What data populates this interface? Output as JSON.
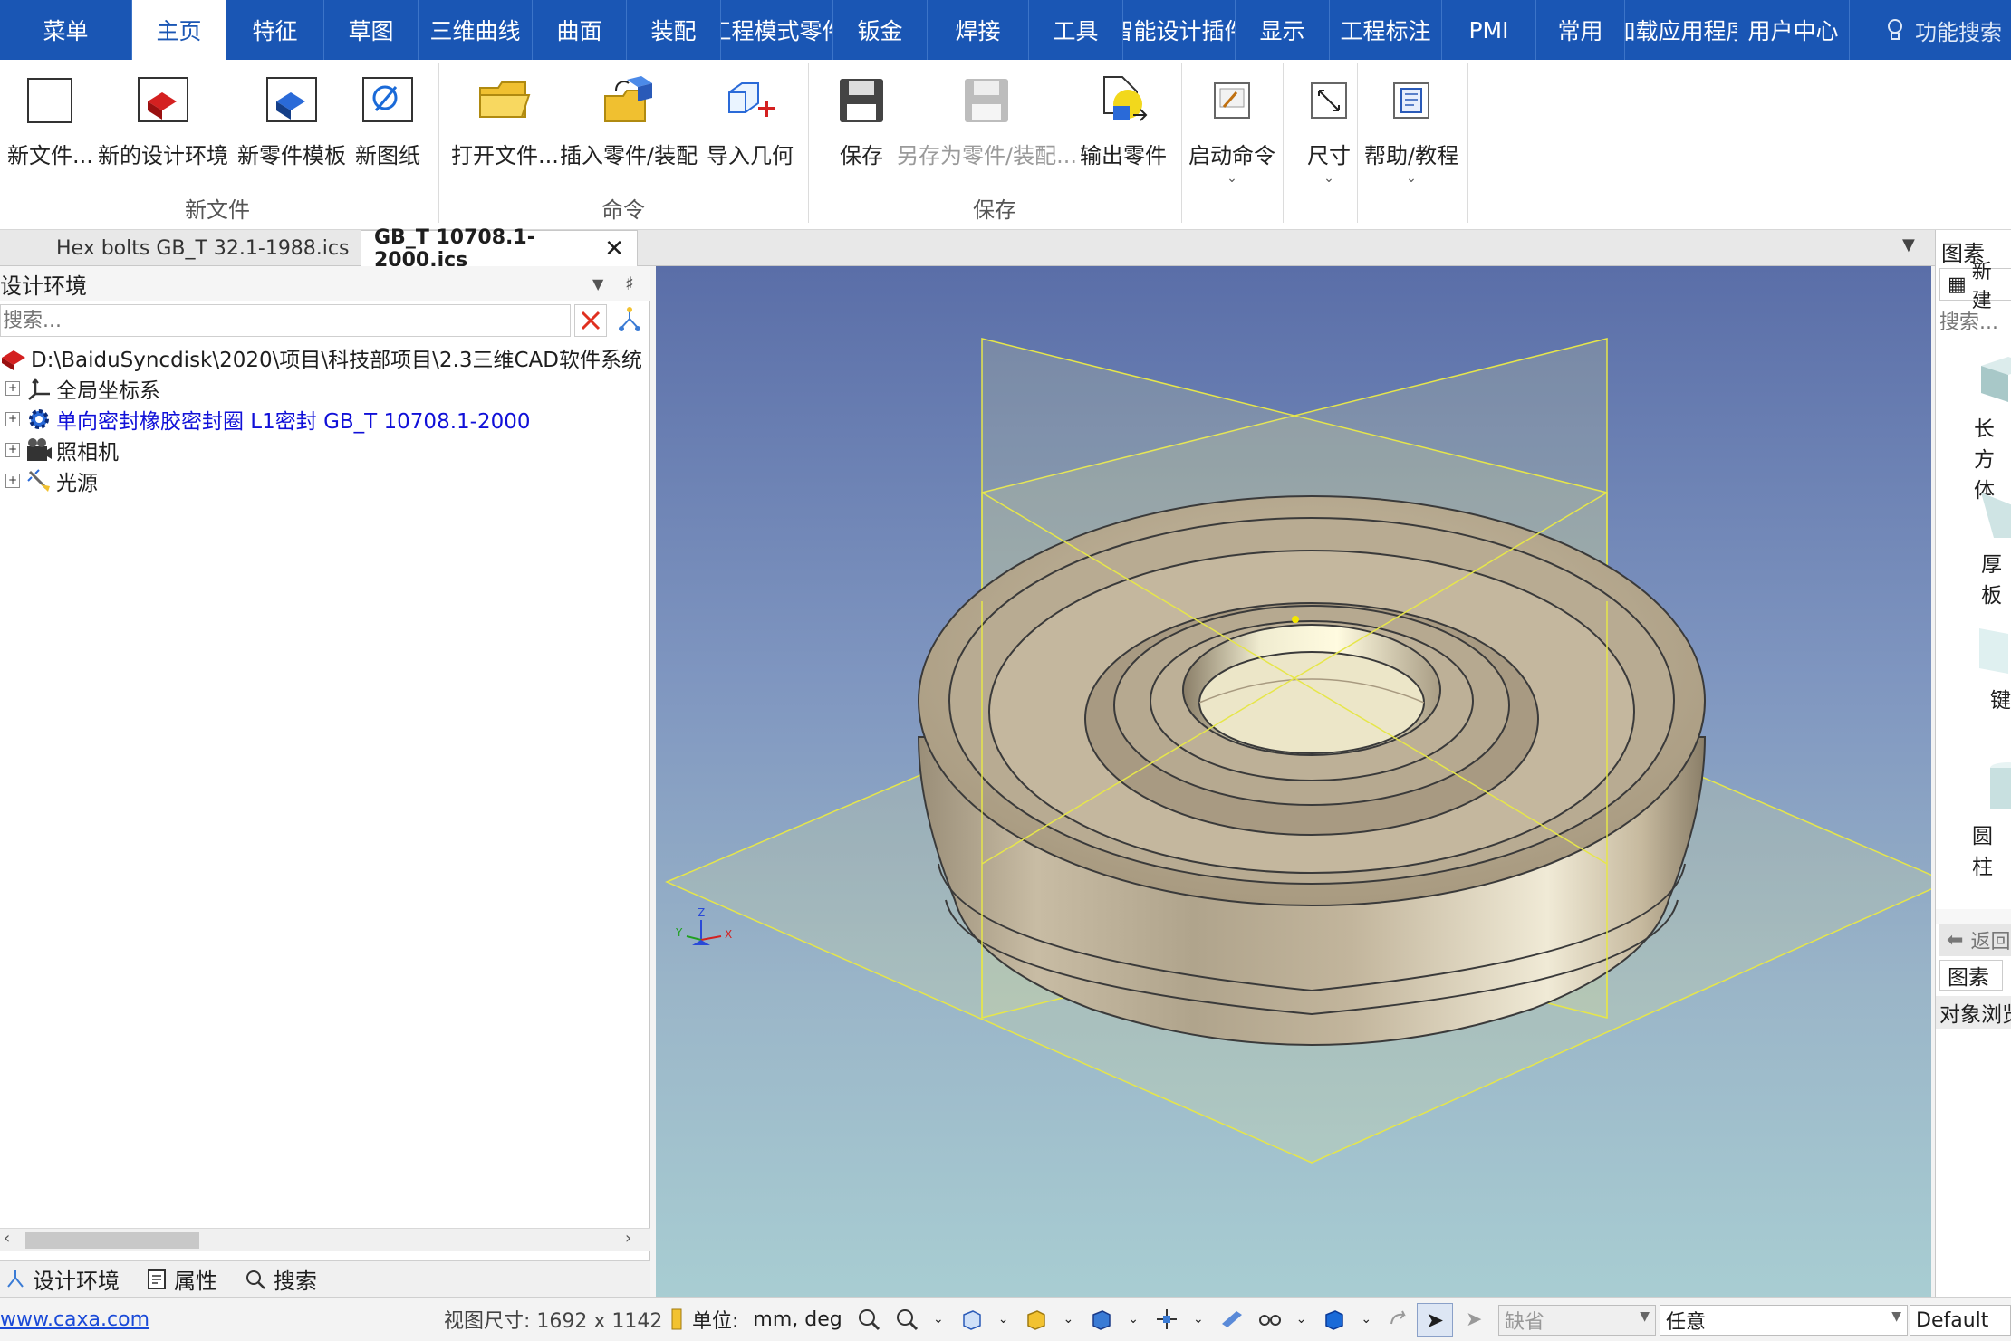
{
  "menubar": {
    "tabs": [
      "菜单",
      "主页",
      "特征",
      "草图",
      "三维曲线",
      "曲面",
      "装配",
      "工程模式零件",
      "钣金",
      "焊接",
      "工具",
      "智能设计插件",
      "显示",
      "工程标注",
      "PMI",
      "常用",
      "加载应用程序",
      "用户中心"
    ],
    "active_tab": "主页",
    "search_label": "功能搜索"
  },
  "ribbon": {
    "buttons": {
      "new_file": "新文件...",
      "new_design_env": "新的设计环境",
      "new_part_template": "新零件模板",
      "new_drawing": "新图纸",
      "open_file": "打开文件...",
      "insert_part": "插入零件/装配",
      "import_geometry": "导入几何",
      "save": "保存",
      "save_as_part": "另存为零件/装配...",
      "export_part": "输出零件",
      "start_command": "启动命令",
      "dimension": "尺寸",
      "help": "帮助/教程"
    },
    "groups": {
      "new_file": "新文件",
      "command": "命令",
      "save": "保存"
    }
  },
  "doc_tabs": [
    {
      "label": "Hex bolts GB_T 32.1-1988.ics",
      "active": false
    },
    {
      "label": "GB_T 10708.1-2000.ics",
      "active": true
    }
  ],
  "left_panel": {
    "title": "设计环境",
    "search_placeholder": "搜索...",
    "tree": {
      "root": "D:\\BaiduSyncdisk\\2020\\项目\\科技部项目\\2.3三维CAD软件系统",
      "items": [
        "全局坐标系",
        "单向密封橡胶密封圈 L1密封 GB_T 10708.1-2000",
        "照相机",
        "光源"
      ]
    },
    "bottom_tabs": [
      "设计环境",
      "属性",
      "搜索"
    ]
  },
  "right_panel": {
    "title": "图素",
    "new_label": "新建",
    "search_placeholder": "搜索...",
    "items": [
      "长方体",
      "厚板",
      "键",
      "圆柱"
    ],
    "back_label": "返回",
    "tab_label": "图素",
    "object_browser": "对象浏览器"
  },
  "statusbar": {
    "link": "www.caxa.com",
    "view_size_label": "视图尺寸: 1692 x 1142",
    "unit_label": "单位:",
    "unit_value": "mm, deg",
    "filter_value": "缺省",
    "select_value": "任意",
    "default_value": "Default"
  },
  "colors": {
    "menubar": "#1a56b4",
    "accent_blue": "#1a56b4",
    "tree_link": "#1010d8",
    "plane_yellow": "#e6e64a"
  }
}
